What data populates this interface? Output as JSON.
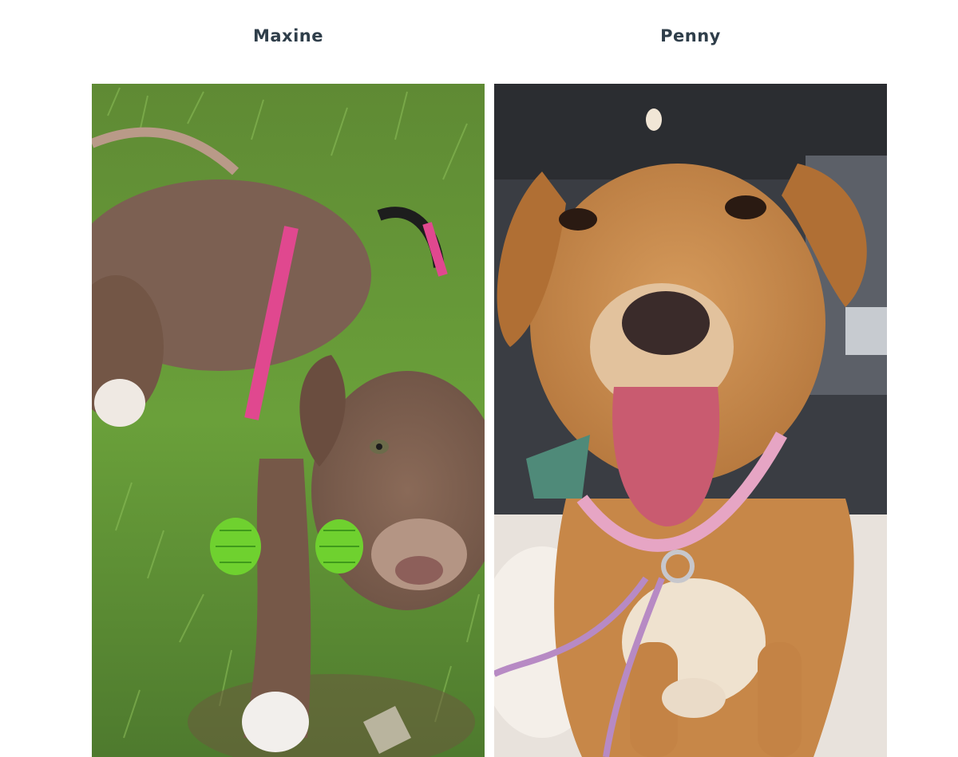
{
  "dogs": [
    {
      "name": "Maxine"
    },
    {
      "name": "Penny"
    }
  ],
  "colors": {
    "title": "#2f3e4a",
    "background": "#ffffff"
  }
}
